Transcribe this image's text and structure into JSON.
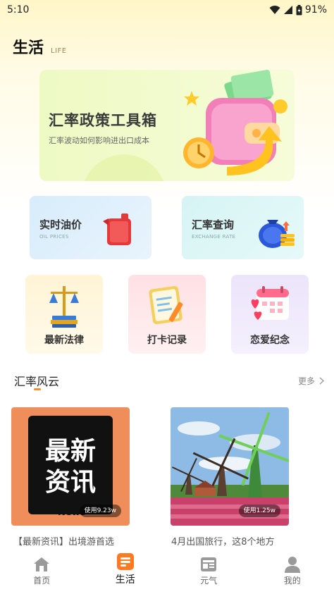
{
  "status": {
    "time": "5:10",
    "battery": "91%"
  },
  "header": {
    "title": "生活",
    "subtitle": "LIFE"
  },
  "banner": {
    "title": "汇率政策工具箱",
    "subtitle": "汇率波动如何影响进出口成本"
  },
  "cards": [
    {
      "title": "实时油价",
      "subtitle": "OIL PRICES"
    },
    {
      "title": "汇率查询",
      "subtitle": "EXCHANGE RATE"
    }
  ],
  "tiles": [
    {
      "label": "最新法律",
      "icon": "scales-law-icon"
    },
    {
      "label": "打卡记录",
      "icon": "clipboard-icon"
    },
    {
      "label": "恋爱纪念",
      "icon": "calendar-heart-icon"
    }
  ],
  "section": {
    "title": "汇率风云",
    "more": "更多"
  },
  "news": [
    {
      "image_text_line1": "最新",
      "image_text_line2": "资讯",
      "image_word": "News",
      "usage": "使用9.23w",
      "caption": "【最新资讯】出境游首选"
    },
    {
      "usage": "使用1.25w",
      "caption": "4月出国旅行，这8个地方"
    }
  ],
  "tabs": [
    {
      "label": "首页",
      "icon": "home-icon",
      "active": false
    },
    {
      "label": "生活",
      "icon": "life-icon",
      "active": true
    },
    {
      "label": "元气",
      "icon": "news-icon",
      "active": false
    },
    {
      "label": "我的",
      "icon": "user-icon",
      "active": false
    }
  ],
  "colors": {
    "accent": "#ff8a2a",
    "banner_bg": "#eefac4"
  }
}
